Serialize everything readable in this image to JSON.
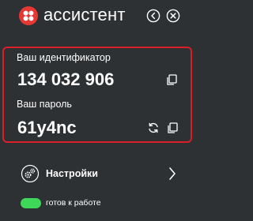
{
  "header": {
    "app_title": "ассистент",
    "logo_icon": "four-dots-logo",
    "back_icon": "back-circle-icon",
    "close_icon": "close-circle-icon"
  },
  "credentials": {
    "id_label": "Ваш идентификатор",
    "id_value": "134 032 906",
    "password_label": "Ваш пароль",
    "password_value": "61y4nc",
    "copy_icon": "copy-icon",
    "refresh_icon": "refresh-icon"
  },
  "settings": {
    "label": "Настройки",
    "icon": "gears-icon",
    "chevron_icon": "chevron-right-icon"
  },
  "status": {
    "label": "готов к работе",
    "toggle_on": true
  },
  "colors": {
    "background": "#2d3134",
    "accent_red": "#d81e27",
    "logo_red": "#e53935",
    "status_green": "#3fd75a",
    "text": "#ffffff"
  }
}
